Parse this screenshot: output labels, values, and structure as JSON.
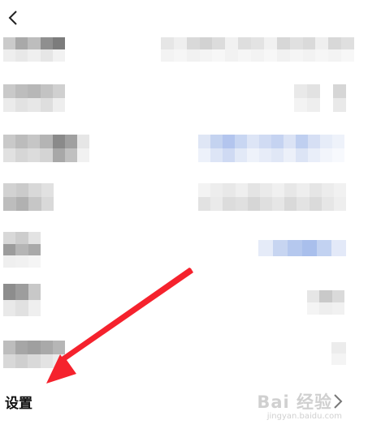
{
  "header": {
    "back_icon": "chevron-left-icon"
  },
  "settings": {
    "label": "设置",
    "chevron_icon": "chevron-right-icon"
  },
  "watermark": {
    "brand": "Bai 经验",
    "url": "jingyan.baidu.com"
  },
  "annotation": {
    "icon": "red-arrow-icon",
    "color": "#f5222d"
  },
  "colors": {
    "blur_gray": "#b9b9b9",
    "blur_blue": "#b4c8ee"
  }
}
